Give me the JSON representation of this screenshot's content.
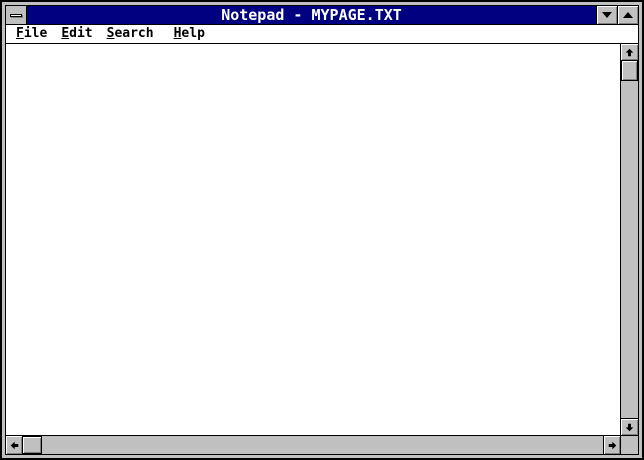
{
  "window": {
    "title": "Notepad - MYPAGE.TXT"
  },
  "titlebar": {
    "system_menu_icon": "dash",
    "minimize_icon": "down-triangle",
    "maximize_icon": "up-triangle"
  },
  "menu": {
    "items": [
      {
        "label": "File",
        "u": "F",
        "rest": "ile"
      },
      {
        "label": "Edit",
        "u": "E",
        "rest": "dit"
      },
      {
        "label": "Search",
        "u": "S",
        "rest": "earch"
      },
      {
        "label": "Help",
        "u": "H",
        "rest": "elp"
      }
    ]
  },
  "editor": {
    "content": ""
  },
  "scrollbars": {
    "vertical": {
      "thumb_position": "top",
      "up_icon": "up-arrow",
      "down_icon": "down-arrow"
    },
    "horizontal": {
      "thumb_position": "left",
      "left_icon": "left-arrow",
      "right_icon": "right-arrow"
    }
  },
  "colors": {
    "titlebar_bg": "#000080",
    "titlebar_text": "#FFFFFF",
    "chrome": "#C0C0C0",
    "bevel_highlight": "#FFFFFF",
    "bevel_shadow": "#808080",
    "border": "#000000",
    "editor_bg": "#FFFFFF"
  }
}
